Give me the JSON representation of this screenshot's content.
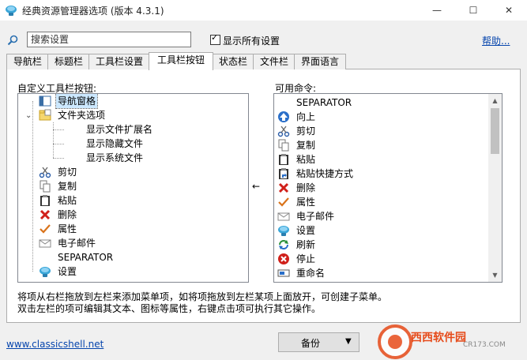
{
  "window": {
    "title": "经典资源管理器选项 (版本 4.3.1)",
    "minimize_glyph": "—",
    "maximize_glyph": "☐",
    "close_glyph": "✕"
  },
  "toolbar": {
    "search_placeholder": "搜索设置",
    "show_all_label": "显示所有设置",
    "show_all_checked": true,
    "help_link": "帮助..."
  },
  "tabs": [
    {
      "label": "导航栏",
      "active": false
    },
    {
      "label": "标题栏",
      "active": false
    },
    {
      "label": "工具栏设置",
      "active": false
    },
    {
      "label": "工具栏按钮",
      "active": true
    },
    {
      "label": "状态栏",
      "active": false
    },
    {
      "label": "文件栏",
      "active": false
    },
    {
      "label": "界面语言",
      "active": false
    }
  ],
  "left_panel": {
    "label": "自定义工具栏按钮:",
    "items": [
      {
        "label": "导航窗格",
        "icon": "nav-pane-icon",
        "selected": true,
        "indent": 0
      },
      {
        "label": "文件夹选项",
        "icon": "folder-options-icon",
        "selected": false,
        "indent": 0,
        "expanded": true
      },
      {
        "label": "显示文件扩展名",
        "icon": "",
        "selected": false,
        "indent": 1
      },
      {
        "label": "显示隐藏文件",
        "icon": "",
        "selected": false,
        "indent": 1
      },
      {
        "label": "显示系统文件",
        "icon": "",
        "selected": false,
        "indent": 1
      },
      {
        "label": "剪切",
        "icon": "scissors-icon",
        "selected": false,
        "indent": 0
      },
      {
        "label": "复制",
        "icon": "copy-icon",
        "selected": false,
        "indent": 0
      },
      {
        "label": "粘贴",
        "icon": "paste-icon",
        "selected": false,
        "indent": 0
      },
      {
        "label": "删除",
        "icon": "delete-icon",
        "selected": false,
        "indent": 0
      },
      {
        "label": "属性",
        "icon": "properties-icon",
        "selected": false,
        "indent": 0
      },
      {
        "label": "电子邮件",
        "icon": "email-icon",
        "selected": false,
        "indent": 0
      },
      {
        "label": "SEPARATOR",
        "icon": "",
        "selected": false,
        "indent": 0
      },
      {
        "label": "设置",
        "icon": "settings-icon",
        "selected": false,
        "indent": 0
      }
    ]
  },
  "middle": {
    "arrow": "←"
  },
  "right_panel": {
    "label": "可用命令:",
    "items": [
      {
        "label": "SEPARATOR",
        "icon": ""
      },
      {
        "label": "向上",
        "icon": "up-icon"
      },
      {
        "label": "剪切",
        "icon": "scissors-icon"
      },
      {
        "label": "复制",
        "icon": "copy-icon"
      },
      {
        "label": "粘贴",
        "icon": "paste-icon"
      },
      {
        "label": "粘贴快捷方式",
        "icon": "paste-shortcut-icon"
      },
      {
        "label": "删除",
        "icon": "delete-icon"
      },
      {
        "label": "属性",
        "icon": "properties-icon"
      },
      {
        "label": "电子邮件",
        "icon": "email-icon"
      },
      {
        "label": "设置",
        "icon": "settings-icon"
      },
      {
        "label": "刷新",
        "icon": "refresh-icon"
      },
      {
        "label": "停止",
        "icon": "stop-icon"
      },
      {
        "label": "重命名",
        "icon": "rename-icon"
      }
    ]
  },
  "help_text": {
    "line1": "将项从右栏拖放到左栏来添加菜单项，如将项拖放到左栏某项上面放开，可创建子菜单。",
    "line2": "双击左栏的项可编辑其文本、图标等属性，右键点击项可执行其它操作。"
  },
  "footer": {
    "link": "www.classicshell.net",
    "backup_label": "备份",
    "watermark_text": "西西软件园",
    "watermark_sub": "CR173.COM"
  },
  "colors": {
    "selection": "#cce8ff",
    "link": "#0645ad",
    "panel_bg": "#ffffff",
    "window_bg": "#f0f0f0"
  }
}
